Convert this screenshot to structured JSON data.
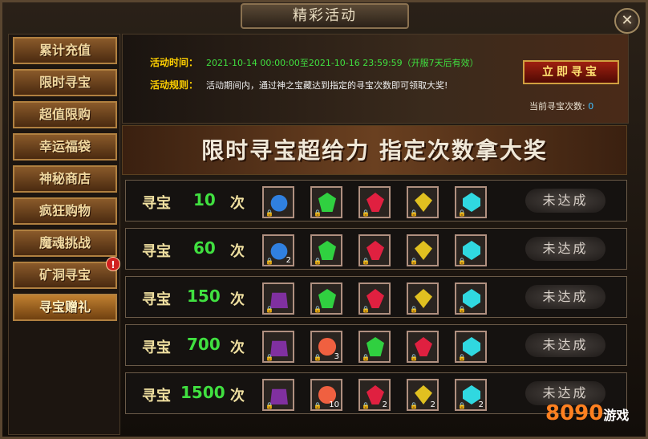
{
  "window": {
    "title": "精彩活动",
    "close_glyph": "✕"
  },
  "sidebar": {
    "items": [
      {
        "label": "累计充值"
      },
      {
        "label": "限时寻宝"
      },
      {
        "label": "超值限购"
      },
      {
        "label": "幸运福袋"
      },
      {
        "label": "神秘商店"
      },
      {
        "label": "疯狂购物"
      },
      {
        "label": "魔魂挑战"
      },
      {
        "label": "矿洞寻宝"
      },
      {
        "label": "寻宝赠礼",
        "active": true
      }
    ],
    "alert_glyph": "!"
  },
  "info": {
    "time_label": "活动时间：",
    "time_value": "2021-10-14 00:00:00至2021-10-16 23:59:59（开服7天后有效）",
    "rule_label": "活动规则：",
    "rule_value": "活动期间内，通过神之宝藏达到指定的寻宝次数即可领取大奖!",
    "find_button": "立即寻宝",
    "count_label": "当前寻宝次数:",
    "count_value": "0"
  },
  "banner": {
    "text": "限时寻宝超给力 指定次数拿大奖"
  },
  "rows_common": {
    "label": "寻宝",
    "unit": "次",
    "status": "未达成"
  },
  "rows": [
    {
      "count": "10",
      "items": [
        {
          "kind": "bag",
          "qty": ""
        },
        {
          "kind": "green",
          "qty": ""
        },
        {
          "kind": "red",
          "qty": ""
        },
        {
          "kind": "yellow",
          "qty": ""
        },
        {
          "kind": "cyan",
          "qty": ""
        }
      ]
    },
    {
      "count": "60",
      "items": [
        {
          "kind": "bag",
          "qty": "2"
        },
        {
          "kind": "green",
          "qty": ""
        },
        {
          "kind": "red",
          "qty": ""
        },
        {
          "kind": "yellow",
          "qty": ""
        },
        {
          "kind": "cyan",
          "qty": ""
        }
      ]
    },
    {
      "count": "150",
      "items": [
        {
          "kind": "chest",
          "qty": ""
        },
        {
          "kind": "green",
          "qty": ""
        },
        {
          "kind": "red",
          "qty": ""
        },
        {
          "kind": "yellow",
          "qty": ""
        },
        {
          "kind": "cyan",
          "qty": ""
        }
      ]
    },
    {
      "count": "700",
      "items": [
        {
          "kind": "chest",
          "qty": ""
        },
        {
          "kind": "orb",
          "qty": "3"
        },
        {
          "kind": "green",
          "qty": ""
        },
        {
          "kind": "red",
          "qty": ""
        },
        {
          "kind": "cyan",
          "qty": ""
        }
      ]
    },
    {
      "count": "1500",
      "items": [
        {
          "kind": "chest",
          "qty": ""
        },
        {
          "kind": "orb",
          "qty": "10"
        },
        {
          "kind": "red",
          "qty": "2"
        },
        {
          "kind": "yellow",
          "qty": "2"
        },
        {
          "kind": "cyan",
          "qty": "2"
        }
      ]
    }
  ],
  "colors": {
    "green": "#30d040",
    "red": "#e02040",
    "yellow": "#e0c020",
    "cyan": "#30d8e0",
    "bag": "#3080e0",
    "chest": "#8030a0",
    "orb": "#f06040"
  },
  "watermark": {
    "brand": "8090",
    "suffix": "游戏"
  }
}
